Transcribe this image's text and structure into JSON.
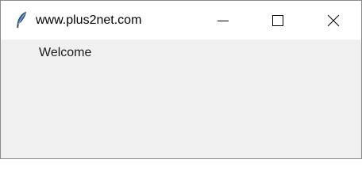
{
  "window": {
    "title": "www.plus2net.com",
    "icon": "feather-icon",
    "controls": {
      "minimize": "minimize-icon",
      "maximize": "maximize-icon",
      "close": "close-icon"
    }
  },
  "content": {
    "label": "Welcome"
  },
  "colors": {
    "titlebar": "#ffffff",
    "client_area": "#f0f0f0",
    "border": "#8a8a8a",
    "text": "#000000"
  }
}
